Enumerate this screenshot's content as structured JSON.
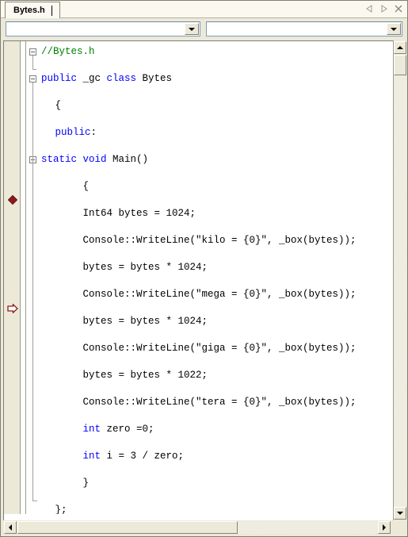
{
  "window": {
    "background_color": "#ece9d8",
    "border_color": "#7f7f76"
  },
  "tabbar": {
    "active_tab_label": "Bytes.h",
    "nav": {
      "prev_label": "Previous document",
      "next_label": "Next document",
      "close_label": "Close"
    }
  },
  "toolbar": {
    "class_combo": {
      "value": "",
      "placeholder": ""
    },
    "member_combo": {
      "value": "",
      "placeholder": ""
    },
    "dropdown_icon": "chevron-down-icon"
  },
  "editor": {
    "language": "C++/CLI",
    "colors": {
      "keyword": "#0000ff",
      "comment": "#008000",
      "text": "#000000",
      "background": "#ffffff",
      "gutter": "#ece9d8",
      "breakpoint": "#8b1a1a",
      "bookmark": "#8b1a1a"
    },
    "breakpoint_line_index": 11,
    "bookmark_line_index": 19,
    "lines": [
      {
        "indent": 0,
        "tokens": [
          {
            "t": "//Bytes.h",
            "c": "cmt"
          }
        ]
      },
      {
        "indent": 0,
        "tokens": [
          {
            "t": "",
            "c": "txt"
          }
        ]
      },
      {
        "indent": 0,
        "tokens": [
          {
            "t": "public",
            "c": "kw"
          },
          {
            "t": " _gc ",
            "c": "txt"
          },
          {
            "t": "class",
            "c": "kw"
          },
          {
            "t": " Bytes",
            "c": "txt"
          }
        ]
      },
      {
        "indent": 0,
        "tokens": [
          {
            "t": "",
            "c": "txt"
          }
        ]
      },
      {
        "indent": 1,
        "tokens": [
          {
            "t": "{",
            "c": "txt"
          }
        ]
      },
      {
        "indent": 0,
        "tokens": [
          {
            "t": "",
            "c": "txt"
          }
        ]
      },
      {
        "indent": 1,
        "tokens": [
          {
            "t": "public",
            "c": "kw"
          },
          {
            "t": ":",
            "c": "txt"
          }
        ]
      },
      {
        "indent": 0,
        "tokens": [
          {
            "t": "",
            "c": "txt"
          }
        ]
      },
      {
        "indent": 0,
        "tokens": [
          {
            "t": "static",
            "c": "kw"
          },
          {
            "t": " ",
            "c": "txt"
          },
          {
            "t": "void",
            "c": "kw"
          },
          {
            "t": " Main()",
            "c": "txt"
          }
        ]
      },
      {
        "indent": 0,
        "tokens": [
          {
            "t": "",
            "c": "txt"
          }
        ]
      },
      {
        "indent": 3,
        "tokens": [
          {
            "t": "{",
            "c": "txt"
          }
        ]
      },
      {
        "indent": 0,
        "tokens": [
          {
            "t": "",
            "c": "txt"
          }
        ]
      },
      {
        "indent": 3,
        "tokens": [
          {
            "t": "Int64 bytes = 1024;",
            "c": "txt"
          }
        ]
      },
      {
        "indent": 0,
        "tokens": [
          {
            "t": "",
            "c": "txt"
          }
        ]
      },
      {
        "indent": 3,
        "tokens": [
          {
            "t": "Console::WriteLine(\"kilo = {0}\", _box(bytes));",
            "c": "txt"
          }
        ]
      },
      {
        "indent": 0,
        "tokens": [
          {
            "t": "",
            "c": "txt"
          }
        ]
      },
      {
        "indent": 3,
        "tokens": [
          {
            "t": "bytes = bytes * 1024;",
            "c": "txt"
          }
        ]
      },
      {
        "indent": 0,
        "tokens": [
          {
            "t": "",
            "c": "txt"
          }
        ]
      },
      {
        "indent": 3,
        "tokens": [
          {
            "t": "Console::WriteLine(\"mega = {0}\", _box(bytes));",
            "c": "txt"
          }
        ]
      },
      {
        "indent": 0,
        "tokens": [
          {
            "t": "",
            "c": "txt"
          }
        ]
      },
      {
        "indent": 3,
        "tokens": [
          {
            "t": "bytes = bytes * 1024;",
            "c": "txt"
          }
        ]
      },
      {
        "indent": 0,
        "tokens": [
          {
            "t": "",
            "c": "txt"
          }
        ]
      },
      {
        "indent": 3,
        "tokens": [
          {
            "t": "Console::WriteLine(\"giga = {0}\", _box(bytes));",
            "c": "txt"
          }
        ]
      },
      {
        "indent": 0,
        "tokens": [
          {
            "t": "",
            "c": "txt"
          }
        ]
      },
      {
        "indent": 3,
        "tokens": [
          {
            "t": "bytes = bytes * 1022;",
            "c": "txt"
          }
        ]
      },
      {
        "indent": 0,
        "tokens": [
          {
            "t": "",
            "c": "txt"
          }
        ]
      },
      {
        "indent": 3,
        "tokens": [
          {
            "t": "Console::WriteLine(\"tera = {0}\", _box(bytes));",
            "c": "txt"
          }
        ]
      },
      {
        "indent": 0,
        "tokens": [
          {
            "t": "",
            "c": "txt"
          }
        ]
      },
      {
        "indent": 3,
        "tokens": [
          {
            "t": "int",
            "c": "kw"
          },
          {
            "t": " zero =0;",
            "c": "txt"
          }
        ]
      },
      {
        "indent": 0,
        "tokens": [
          {
            "t": "",
            "c": "txt"
          }
        ]
      },
      {
        "indent": 3,
        "tokens": [
          {
            "t": "int",
            "c": "kw"
          },
          {
            "t": " i = 3 / zero;",
            "c": "txt"
          }
        ]
      },
      {
        "indent": 0,
        "tokens": [
          {
            "t": "",
            "c": "txt"
          }
        ]
      },
      {
        "indent": 3,
        "tokens": [
          {
            "t": "}",
            "c": "txt"
          }
        ]
      },
      {
        "indent": 0,
        "tokens": [
          {
            "t": "",
            "c": "txt"
          }
        ]
      },
      {
        "indent": 1,
        "tokens": [
          {
            "t": "};",
            "c": "txt"
          }
        ]
      }
    ],
    "fold_boxes": [
      {
        "line": 0,
        "name": "fold-toggle-comment"
      },
      {
        "line": 2,
        "name": "fold-toggle-class"
      },
      {
        "line": 8,
        "name": "fold-toggle-main"
      }
    ]
  },
  "scrollbars": {
    "vertical": {
      "up_icon": "triangle-up-icon",
      "down_icon": "triangle-down-icon",
      "thumb_label": "vertical-thumb"
    },
    "horizontal": {
      "left_icon": "triangle-left-icon",
      "right_icon": "triangle-right-icon",
      "thumb_label": "horizontal-thumb"
    }
  }
}
